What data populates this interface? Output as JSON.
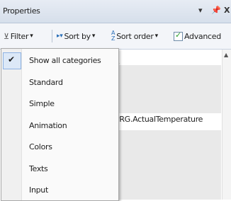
{
  "panel": {
    "title": "Properties",
    "pin_glyph": "▾",
    "pin2_glyph": "ꟷ",
    "close_glyph": "X"
  },
  "toolbar": {
    "filter_label": "Filter",
    "sortby_label": "Sort by",
    "sortorder_label": "Sort order",
    "advanced_label": "Advanced",
    "advanced_checked": true,
    "dropdown_glyph": "▾"
  },
  "grid": {
    "visible_value_fragment": "e",
    "visible_value_row": "PRG.ActualTemperature"
  },
  "filter_menu": {
    "items": [
      {
        "label": "Show all categories",
        "checked": true
      },
      {
        "label": "Standard",
        "checked": false
      },
      {
        "label": "Simple",
        "checked": false
      },
      {
        "label": "Animation",
        "checked": false
      },
      {
        "label": "Colors",
        "checked": false
      },
      {
        "label": "Texts",
        "checked": false
      },
      {
        "label": "Input",
        "checked": false
      }
    ]
  }
}
